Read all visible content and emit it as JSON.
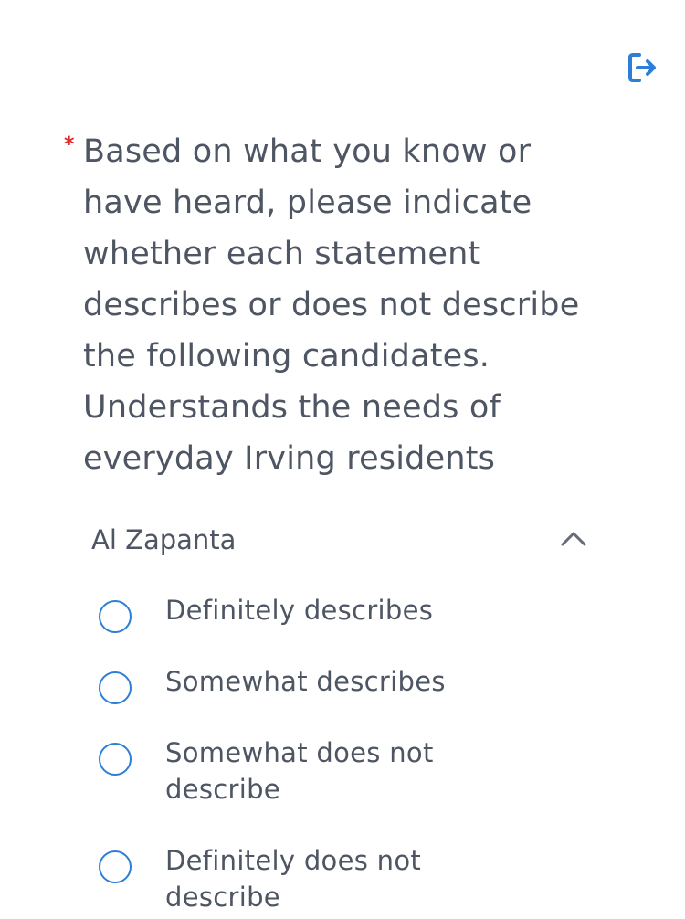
{
  "colors": {
    "text": "#4e5563",
    "required": "#e52828",
    "accent": "#2d7ed6",
    "chevron": "#666c75"
  },
  "header": {
    "exit_icon": "exit-icon"
  },
  "question": {
    "required_marker": "*",
    "lines": [
      "Based on what you know or",
      "have heard, please indicate",
      "whether each statement",
      "describes or does not describe",
      "the following candidates.",
      "Understands the needs of",
      "everyday Irving residents"
    ]
  },
  "candidate": {
    "name": "Al Zapanta",
    "toggle_icon": "chevron-up-icon",
    "options": [
      {
        "lines": [
          "Definitely describes"
        ]
      },
      {
        "lines": [
          "Somewhat describes"
        ]
      },
      {
        "lines": [
          "Somewhat does not",
          "describe"
        ]
      },
      {
        "lines": [
          "Definitely does not",
          "describe"
        ]
      }
    ]
  }
}
